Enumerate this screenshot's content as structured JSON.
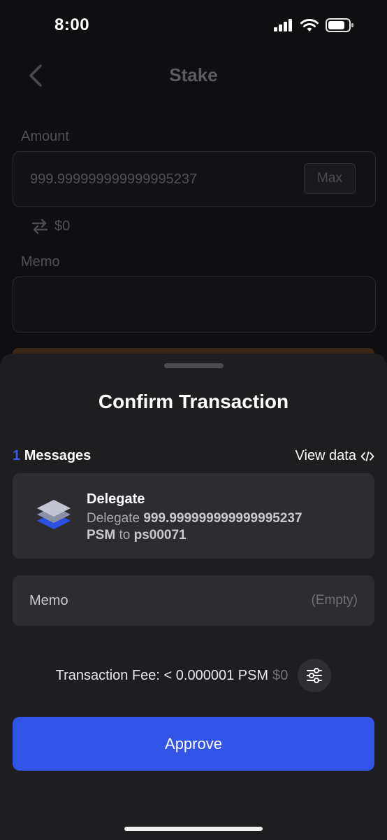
{
  "status_bar": {
    "time": "8:00"
  },
  "background_page": {
    "title": "Stake",
    "amount_label": "Amount",
    "amount_value": "999.999999999999995237",
    "max_label": "Max",
    "fiat_value": "$0",
    "memo_label": "Memo"
  },
  "sheet": {
    "title": "Confirm Transaction",
    "messages_count": "1",
    "messages_label": "Messages",
    "view_data_label": "View data",
    "message": {
      "title": "Delegate",
      "verb": "Delegate",
      "amount": "999.999999999999995237",
      "denom": "PSM",
      "to_word": "to",
      "recipient": "ps00071"
    },
    "memo_label": "Memo",
    "memo_value": "(Empty)",
    "fee_text": "Transaction Fee: < 0.000001 PSM",
    "fee_usd": "$0",
    "approve_label": "Approve"
  },
  "colors": {
    "accent": "#3154e8",
    "sheet_bg": "#1e1e21",
    "card_bg": "#2c2c31",
    "count_color": "#3b5bef"
  }
}
